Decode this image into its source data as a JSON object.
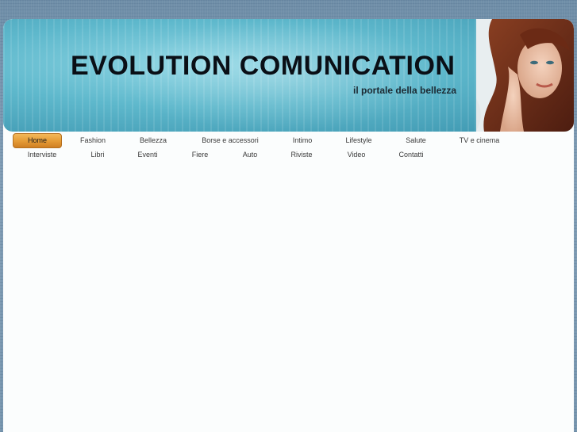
{
  "header": {
    "title": "EVOLUTION COMUNICATION",
    "tagline": "il portale della bellezza"
  },
  "nav": {
    "row1": [
      "Home",
      "Fashion",
      "Bellezza",
      "Borse e accessori",
      "Intimo",
      "Lifestyle",
      "Salute",
      "TV e cinema"
    ],
    "row2": [
      "Interviste",
      "Libri",
      "Eventi",
      "Fiere",
      "Auto",
      "Riviste",
      "Video",
      "Contatti"
    ],
    "active": "Home"
  },
  "colors": {
    "header_teal": "#5eb8cc",
    "active_tab": "#e49a35",
    "background_denim": "#7695ae"
  }
}
